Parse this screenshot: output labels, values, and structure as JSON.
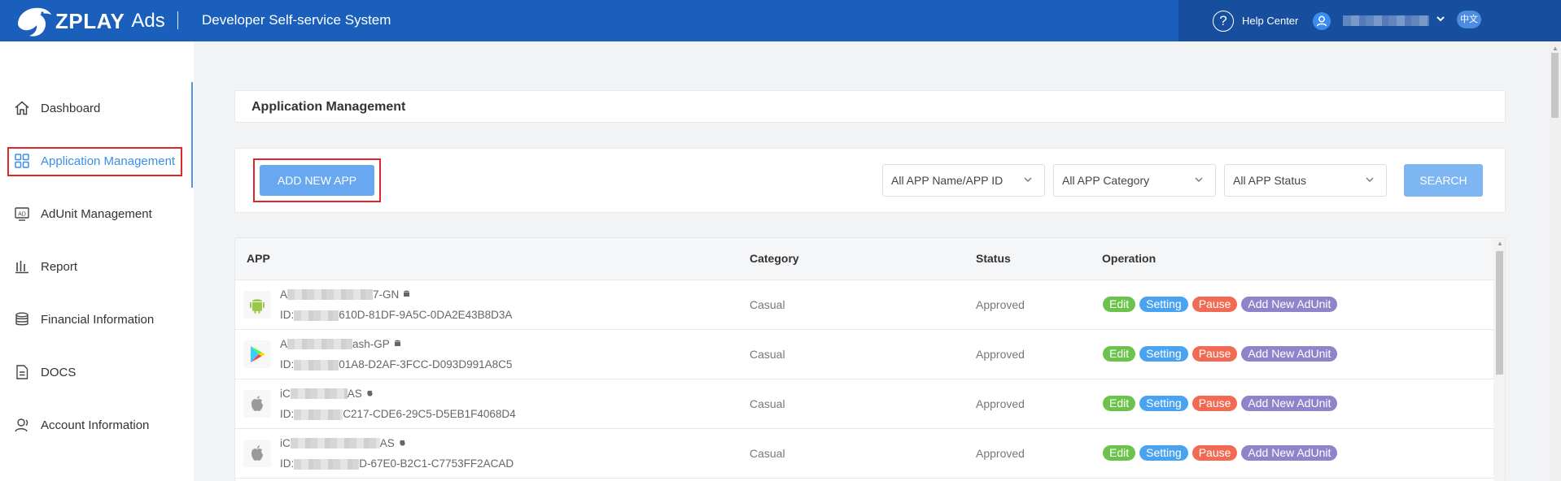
{
  "header": {
    "logo_text": "ZPLAY",
    "logo_suffix": "Ads",
    "system_title": "Developer Self-service System",
    "help_label": "Help Center",
    "help_glyph": "?",
    "lang_label": "中文"
  },
  "sidebar": {
    "items": [
      {
        "label": "Dashboard",
        "icon": "home-icon"
      },
      {
        "label": "Application Management",
        "icon": "grid-icon",
        "active": true
      },
      {
        "label": "AdUnit Management",
        "icon": "ad-icon"
      },
      {
        "label": "Report",
        "icon": "bar-chart-icon"
      },
      {
        "label": "Financial Information",
        "icon": "coins-icon"
      },
      {
        "label": "DOCS",
        "icon": "document-icon"
      },
      {
        "label": "Account Information",
        "icon": "user-icon"
      }
    ]
  },
  "page": {
    "title": "Application Management"
  },
  "toolbar": {
    "add_label": "ADD NEW APP",
    "filters": [
      "All APP Name/APP ID",
      "All APP Category",
      "All APP Status"
    ],
    "search_label": "SEARCH"
  },
  "table": {
    "columns": [
      "APP",
      "Category",
      "Status",
      "Operation"
    ],
    "operations": [
      "Edit",
      "Setting",
      "Pause",
      "Add New AdUnit"
    ],
    "rows": [
      {
        "platform": "android",
        "name_start": "A",
        "name_end": "7-GN",
        "id_prefix": "ID:",
        "id_end": "610D-81DF-9A5C-0DA2E43B8D3A",
        "category": "Casual",
        "status": "Approved"
      },
      {
        "platform": "google-play",
        "name_start": "A",
        "name_end": "ash-GP",
        "id_prefix": "ID:",
        "id_end": "01A8-D2AF-3FCC-D093D991A8C5",
        "category": "Casual",
        "status": "Approved"
      },
      {
        "platform": "ios",
        "name_start": "iC",
        "name_end": "AS",
        "id_prefix": "ID:",
        "id_end": "C217-CDE6-29C5-D5EB1F4068D4",
        "category": "Casual",
        "status": "Approved"
      },
      {
        "platform": "ios",
        "name_start": "iC",
        "name_end": "AS",
        "id_prefix": "ID:",
        "id_end": "D-67E0-B2C1-C7753FF2ACAD",
        "category": "Casual",
        "status": "Approved"
      }
    ]
  },
  "colors": {
    "header": "#1b5fbd",
    "accent": "#3a8ee6",
    "edit": "#6cc34b",
    "setting": "#4aa3f0",
    "pause": "#f26a53",
    "adunit": "#8f83c9",
    "highlight": "#e0262b"
  }
}
